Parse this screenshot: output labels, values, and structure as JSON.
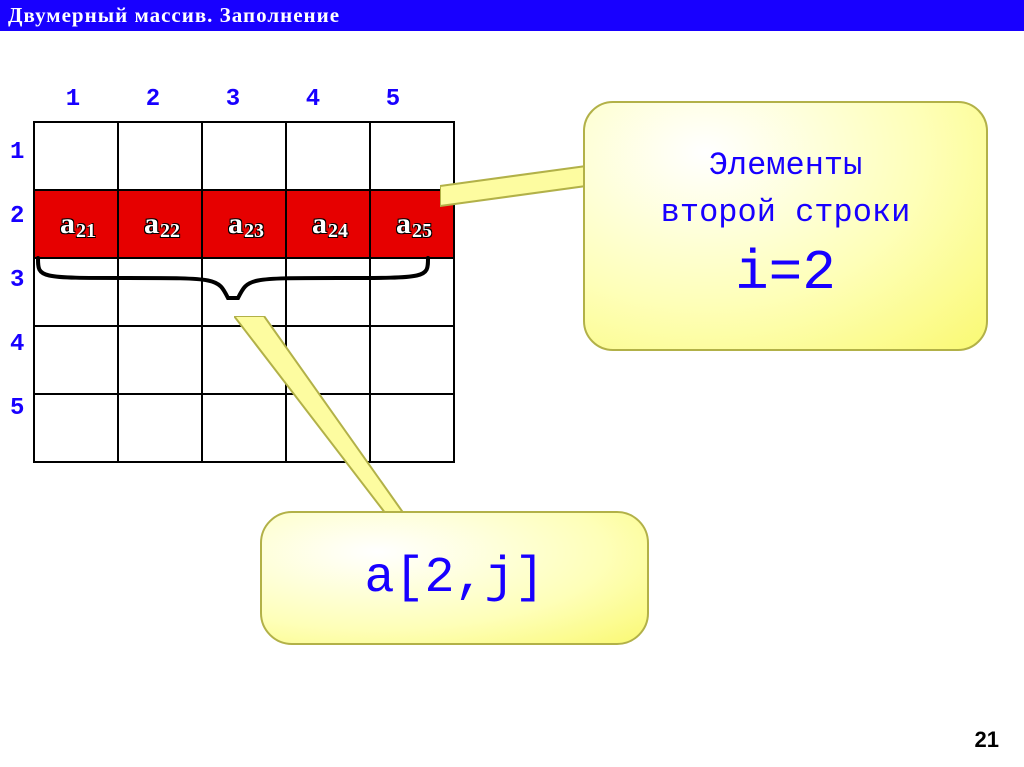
{
  "title": "Двумерный массив. Заполнение",
  "columns": [
    "1",
    "2",
    "3",
    "4",
    "5"
  ],
  "rows": [
    "1",
    "2",
    "3",
    "4",
    "5"
  ],
  "highlight_row": 2,
  "row_cells": [
    {
      "name": "a",
      "sub": "21"
    },
    {
      "name": "a",
      "sub": "22"
    },
    {
      "name": "a",
      "sub": "23"
    },
    {
      "name": "a",
      "sub": "24"
    },
    {
      "name": "a",
      "sub": "25"
    }
  ],
  "right_callout": {
    "line1": "Элементы",
    "line2": "второй строки",
    "line3": "i=2"
  },
  "bottom_callout": "a[2,j]",
  "page_number": "21"
}
